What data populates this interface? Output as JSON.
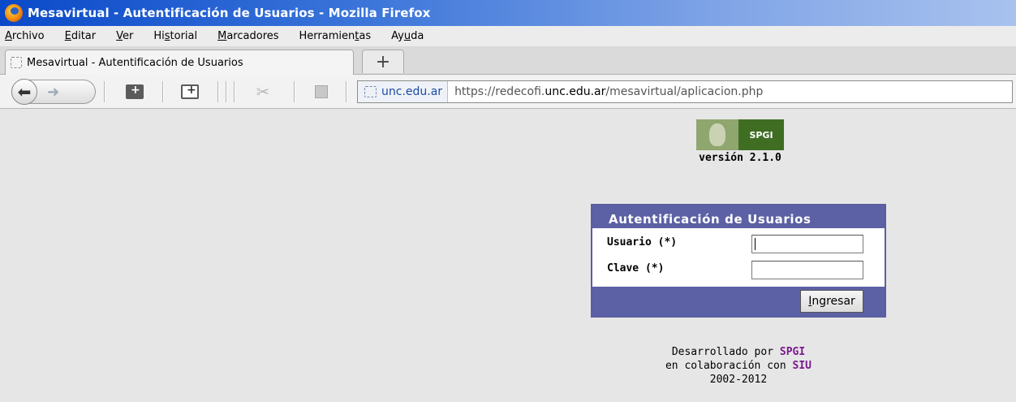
{
  "window": {
    "title": "Mesavirtual - Autentificación de Usuarios - Mozilla Firefox"
  },
  "menu": {
    "items": [
      {
        "label": "Archivo",
        "accel": "A",
        "rest": "rchivo"
      },
      {
        "label": "Editar",
        "accel": "E",
        "rest": "ditar"
      },
      {
        "label": "Ver",
        "accel": "V",
        "rest": "er"
      },
      {
        "label": "Historial",
        "pre": "Hi",
        "accel": "s",
        "rest": "torial"
      },
      {
        "label": "Marcadores",
        "accel": "M",
        "rest": "arcadores"
      },
      {
        "label": "Herramientas",
        "pre": "Herramien",
        "accel": "t",
        "rest": "as"
      },
      {
        "label": "Ayuda",
        "pre": "Ay",
        "accel": "u",
        "rest": "da"
      }
    ]
  },
  "tabs": [
    {
      "label": "Mesavirtual - Autentificación de Usuarios",
      "active": true
    }
  ],
  "new_tab_label": "+",
  "navbar": {
    "identity_label": "unc.edu.ar",
    "url_prefix": "https://redecofi.",
    "url_domain": "unc.edu.ar",
    "url_suffix": "/mesavirtual/aplicacion.php"
  },
  "page": {
    "logo_text": "SPGI",
    "version": "versión 2.1.0",
    "login": {
      "title": "Autentificación de Usuarios",
      "user_label": "Usuario (*)",
      "user_value": "",
      "password_label": "Clave (*)",
      "password_value": "",
      "submit_accel": "I",
      "submit_rest": "ngresar"
    },
    "footer": {
      "line1_pre": "Desarrollado por ",
      "line1_org": "SPGI",
      "line2_pre": "en colaboración con ",
      "line2_org": "SIU",
      "line3": "2002-2012"
    }
  },
  "colors": {
    "titlebar": "#0a49c9",
    "login_header": "#5c60a4",
    "logo_green": "#3f6e23",
    "footer_highlight": "#7a1a8f"
  }
}
